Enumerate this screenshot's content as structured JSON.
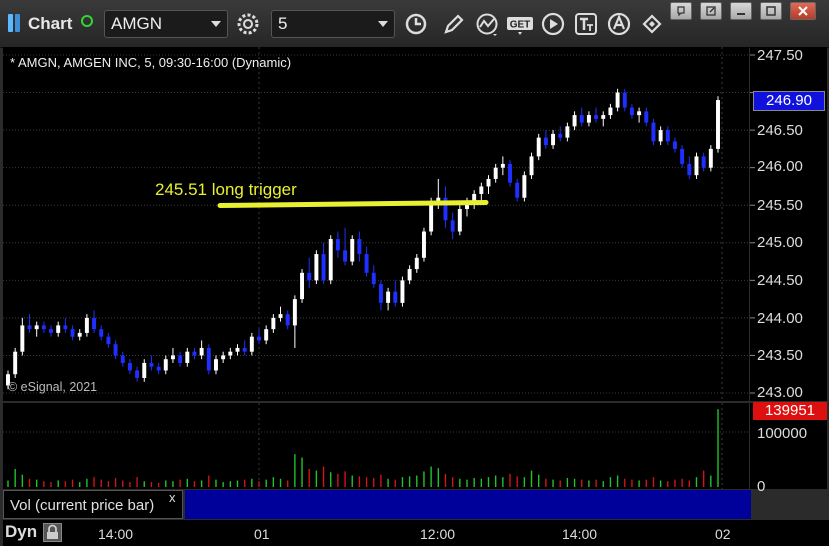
{
  "toolbar": {
    "title": "Chart",
    "symbol": "AMGN",
    "interval": "5",
    "get_label": "GET"
  },
  "chart_info": "* AMGN, AMGEN INC, 5, 09:30-16:00 (Dynamic)",
  "copyright": "© eSignal, 2021",
  "annotation": "245.51 long trigger",
  "volume_study": "Vol (current price bar)",
  "close_glyph": "x",
  "dyn_label": "Dyn",
  "colors": {
    "up": "#ffffff",
    "down": "#1f2fff",
    "trigger": "#e8f030",
    "vol_up": "#22c22a",
    "vol_down": "#d01515"
  },
  "chart_data": {
    "type": "candlestick",
    "price_axis": {
      "ylim": [
        243.0,
        247.5
      ],
      "ticks": [
        "247.50",
        "247.00",
        "246.50",
        "246.00",
        "245.50",
        "245.00",
        "244.50",
        "244.00",
        "243.50",
        "243.00"
      ]
    },
    "volume_axis": {
      "ticks": [
        "100000",
        "0"
      ]
    },
    "time_labels": [
      "14:00",
      "01",
      "12:00",
      "14:00",
      "02"
    ],
    "last_price": "246.90",
    "last_volume": "139951",
    "trigger_level": 245.51,
    "candles": [
      [
        243.1,
        243.3,
        243.05,
        243.25
      ],
      [
        243.25,
        243.6,
        243.2,
        243.55
      ],
      [
        243.55,
        244.0,
        243.5,
        243.9
      ],
      [
        243.9,
        244.05,
        243.8,
        243.85
      ],
      [
        243.85,
        243.95,
        243.75,
        243.9
      ],
      [
        243.9,
        243.95,
        243.8,
        243.85
      ],
      [
        243.85,
        243.9,
        243.75,
        243.8
      ],
      [
        243.8,
        243.95,
        243.75,
        243.9
      ],
      [
        243.9,
        244.0,
        243.8,
        243.85
      ],
      [
        243.85,
        243.9,
        243.7,
        243.75
      ],
      [
        243.75,
        243.85,
        243.7,
        243.8
      ],
      [
        243.8,
        244.05,
        243.75,
        244.0
      ],
      [
        244.0,
        244.1,
        243.8,
        243.85
      ],
      [
        243.85,
        243.9,
        243.7,
        243.75
      ],
      [
        243.75,
        243.8,
        243.6,
        243.65
      ],
      [
        243.65,
        243.7,
        243.45,
        243.5
      ],
      [
        243.5,
        243.55,
        243.35,
        243.4
      ],
      [
        243.4,
        243.45,
        243.25,
        243.3
      ],
      [
        243.3,
        243.35,
        243.15,
        243.2
      ],
      [
        243.2,
        243.45,
        243.15,
        243.4
      ],
      [
        243.4,
        243.5,
        243.3,
        243.35
      ],
      [
        243.35,
        243.4,
        243.25,
        243.3
      ],
      [
        243.3,
        243.5,
        243.25,
        243.45
      ],
      [
        243.45,
        243.6,
        243.4,
        243.5
      ],
      [
        243.5,
        243.55,
        243.35,
        243.4
      ],
      [
        243.4,
        243.6,
        243.35,
        243.55
      ],
      [
        243.55,
        243.6,
        243.45,
        243.5
      ],
      [
        243.5,
        243.7,
        243.45,
        243.6
      ],
      [
        243.6,
        243.65,
        243.25,
        243.3
      ],
      [
        243.3,
        243.5,
        243.25,
        243.45
      ],
      [
        243.45,
        243.55,
        243.4,
        243.5
      ],
      [
        243.5,
        243.6,
        243.45,
        243.55
      ],
      [
        243.55,
        243.65,
        243.5,
        243.6
      ],
      [
        243.6,
        243.7,
        243.5,
        243.55
      ],
      [
        243.55,
        243.8,
        243.5,
        243.75
      ],
      [
        243.75,
        243.85,
        243.65,
        243.7
      ],
      [
        243.7,
        243.9,
        243.65,
        243.85
      ],
      [
        243.85,
        244.05,
        243.8,
        244.0
      ],
      [
        244.0,
        244.15,
        243.95,
        244.05
      ],
      [
        244.05,
        244.1,
        243.85,
        243.9
      ],
      [
        243.9,
        244.3,
        243.6,
        244.25
      ],
      [
        244.25,
        244.65,
        244.2,
        244.6
      ],
      [
        244.6,
        244.8,
        244.4,
        244.5
      ],
      [
        244.5,
        244.9,
        244.45,
        244.85
      ],
      [
        244.85,
        245.0,
        244.45,
        244.5
      ],
      [
        244.5,
        245.1,
        244.45,
        245.05
      ],
      [
        245.05,
        245.15,
        244.8,
        244.9
      ],
      [
        244.9,
        245.2,
        244.7,
        244.75
      ],
      [
        244.75,
        245.1,
        244.7,
        245.05
      ],
      [
        245.05,
        245.15,
        244.75,
        244.85
      ],
      [
        244.85,
        244.95,
        244.55,
        244.6
      ],
      [
        244.6,
        244.7,
        244.4,
        244.45
      ],
      [
        244.45,
        244.5,
        244.1,
        244.2
      ],
      [
        244.2,
        244.4,
        244.1,
        244.35
      ],
      [
        244.35,
        244.5,
        244.15,
        244.2
      ],
      [
        244.2,
        244.55,
        244.15,
        244.5
      ],
      [
        244.5,
        244.7,
        244.45,
        244.65
      ],
      [
        244.65,
        244.85,
        244.6,
        244.8
      ],
      [
        244.8,
        245.2,
        244.75,
        245.15
      ],
      [
        245.15,
        245.6,
        245.1,
        245.55
      ],
      [
        245.55,
        245.85,
        245.45,
        245.6
      ],
      [
        245.6,
        245.75,
        245.2,
        245.3
      ],
      [
        245.3,
        245.4,
        245.05,
        245.15
      ],
      [
        245.15,
        245.5,
        245.1,
        245.45
      ],
      [
        245.45,
        245.6,
        245.35,
        245.55
      ],
      [
        245.55,
        245.7,
        245.45,
        245.65
      ],
      [
        245.65,
        245.8,
        245.55,
        245.75
      ],
      [
        245.75,
        245.9,
        245.65,
        245.85
      ],
      [
        245.85,
        246.05,
        245.8,
        246.0
      ],
      [
        246.0,
        246.15,
        245.9,
        246.05
      ],
      [
        246.05,
        246.1,
        245.75,
        245.8
      ],
      [
        245.8,
        245.85,
        245.55,
        245.6
      ],
      [
        245.6,
        245.95,
        245.55,
        245.9
      ],
      [
        245.9,
        246.2,
        245.85,
        246.15
      ],
      [
        246.15,
        246.45,
        246.1,
        246.4
      ],
      [
        246.4,
        246.5,
        246.25,
        246.3
      ],
      [
        246.3,
        246.5,
        246.25,
        246.45
      ],
      [
        246.45,
        246.55,
        246.35,
        246.4
      ],
      [
        246.4,
        246.6,
        246.35,
        246.55
      ],
      [
        246.55,
        246.75,
        246.5,
        246.7
      ],
      [
        246.7,
        246.8,
        246.55,
        246.6
      ],
      [
        246.6,
        246.75,
        246.55,
        246.7
      ],
      [
        246.7,
        246.8,
        246.6,
        246.65
      ],
      [
        246.65,
        246.75,
        246.55,
        246.7
      ],
      [
        246.7,
        246.85,
        246.65,
        246.8
      ],
      [
        246.8,
        247.05,
        246.75,
        247.0
      ],
      [
        247.0,
        247.05,
        246.75,
        246.8
      ],
      [
        246.8,
        246.85,
        246.65,
        246.7
      ],
      [
        246.7,
        246.8,
        246.6,
        246.75
      ],
      [
        246.75,
        246.8,
        246.55,
        246.6
      ],
      [
        246.6,
        246.65,
        246.3,
        246.35
      ],
      [
        246.35,
        246.55,
        246.3,
        246.5
      ],
      [
        246.5,
        246.55,
        246.3,
        246.35
      ],
      [
        246.35,
        246.4,
        246.2,
        246.25
      ],
      [
        246.25,
        246.3,
        246.0,
        246.05
      ],
      [
        246.05,
        246.15,
        245.85,
        245.9
      ],
      [
        245.9,
        246.2,
        245.85,
        246.15
      ],
      [
        246.15,
        246.2,
        245.95,
        246.0
      ],
      [
        246.0,
        246.3,
        245.95,
        246.25
      ],
      [
        246.25,
        246.95,
        246.2,
        246.9
      ]
    ],
    "volume": [
      8,
      22,
      15,
      10,
      9,
      7,
      6,
      8,
      7,
      9,
      6,
      10,
      12,
      9,
      7,
      11,
      8,
      6,
      12,
      7,
      6,
      5,
      8,
      7,
      9,
      10,
      7,
      8,
      14,
      9,
      6,
      7,
      8,
      9,
      10,
      7,
      9,
      12,
      10,
      8,
      40,
      36,
      22,
      20,
      25,
      18,
      16,
      19,
      14,
      13,
      12,
      11,
      15,
      10,
      9,
      12,
      13,
      14,
      19,
      25,
      23,
      16,
      12,
      10,
      9,
      11,
      10,
      12,
      14,
      12,
      16,
      13,
      12,
      20,
      15,
      10,
      9,
      8,
      11,
      10,
      9,
      8,
      9,
      7,
      12,
      14,
      10,
      9,
      8,
      9,
      12,
      8,
      7,
      9,
      10,
      8,
      12,
      20,
      14,
      95
    ]
  }
}
